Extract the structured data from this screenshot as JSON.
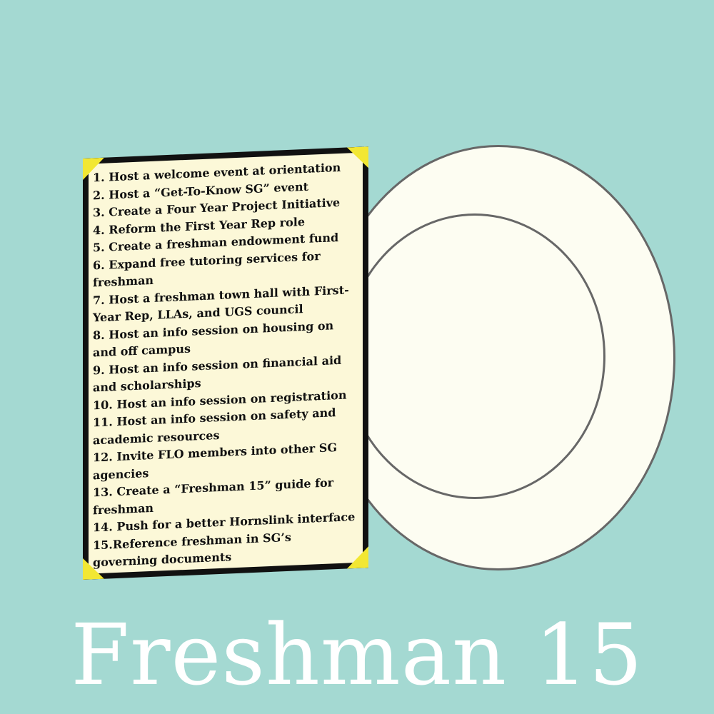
{
  "title": "Freshman 15",
  "colors": {
    "background": "#a4d9d2",
    "plate": "#fdfdf2",
    "plate_rim": "#676767",
    "card_border": "#111111",
    "card_paper": "#fcf8d8",
    "card_corner": "#f2e733",
    "title_text": "#ffffff"
  },
  "menu": {
    "items": [
      "1. Host a welcome event at orientation",
      "2. Host a “Get-To-Know SG” event",
      "3. Create a Four Year Project Initiative",
      "4. Reform the First Year Rep role",
      "5. Create a freshman  endowment fund",
      "6. Expand free tutoring services for freshman",
      "7. Host a freshman town hall with First-Year Rep, LLAs, and UGS council",
      "8. Host an info session on housing on and off  campus",
      "9. Host an info session on financial aid and scholarships",
      "10. Host an info session on registration",
      "11. Host an info session on safety and academic resources",
      "12. Invite FLO members into other SG agencies",
      "13. Create a “Freshman 15” guide for freshman",
      "14. Push for a better Hornslink interface",
      "15.Reference freshman in SG’s governing documents"
    ]
  }
}
